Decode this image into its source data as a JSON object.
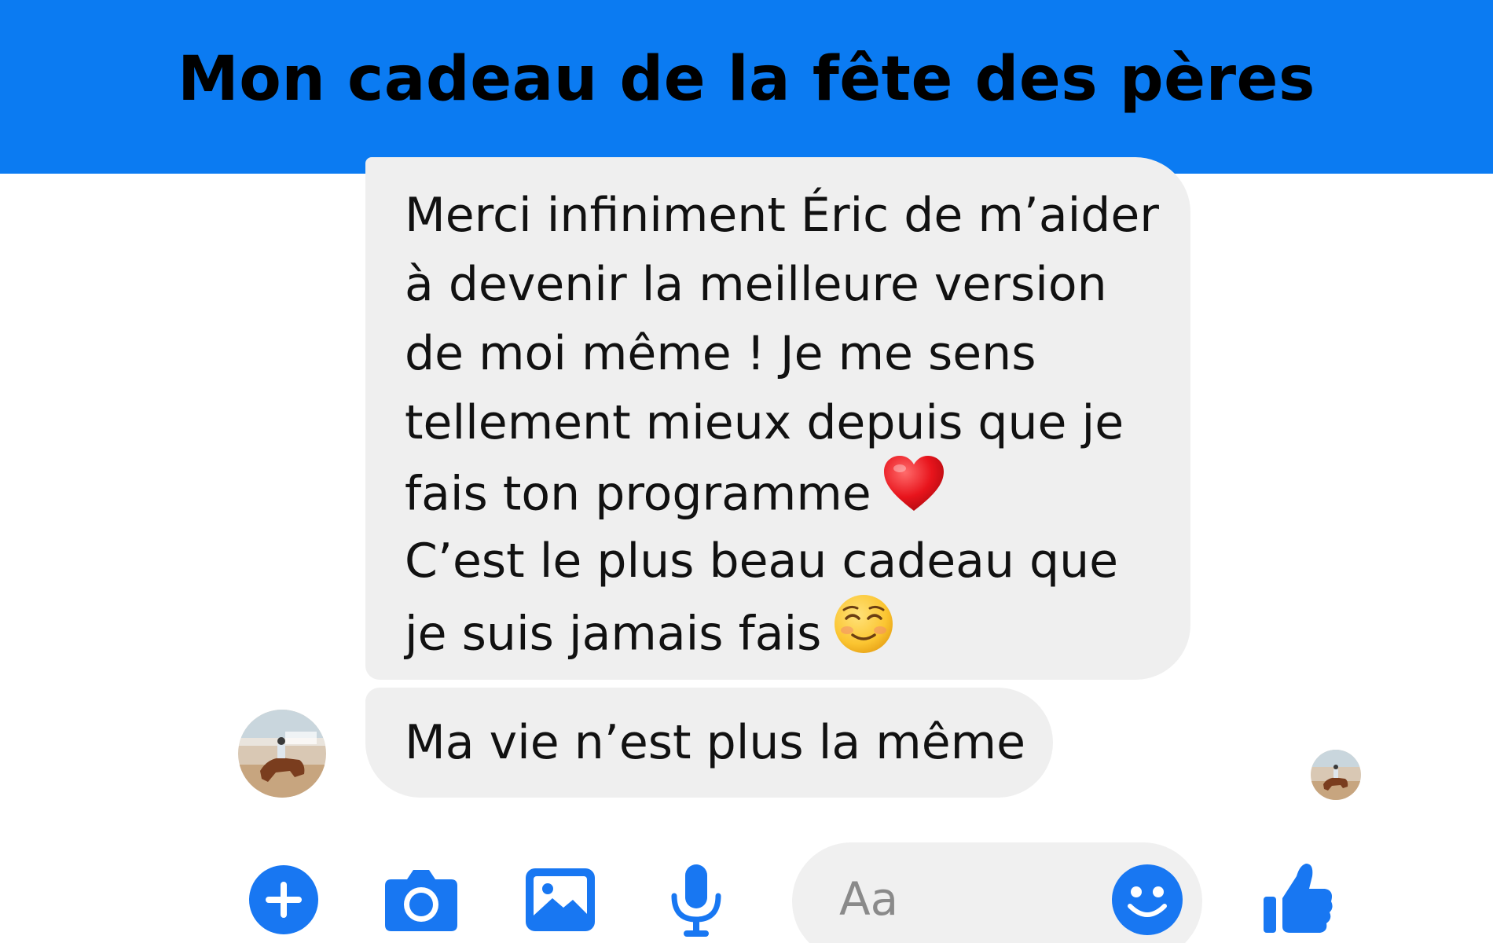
{
  "banner": {
    "title": "Mon cadeau de la fête des pères",
    "color": "#0b7bf2"
  },
  "conversation": {
    "messages": [
      {
        "lines": [
          "Merci infiniment Éric de m’aider",
          "à devenir la meilleure version",
          "de moi même ! Je me sens",
          "tellement mieux depuis que je",
          "fais ton programme",
          "C’est le plus beau cadeau que",
          "je suis jamais fais"
        ],
        "emojis": [
          "red-heart",
          "smiling-face"
        ]
      },
      {
        "text": "Ma vie n’est plus la même"
      }
    ],
    "sender_avatar": "horse-rider-photo",
    "read_receipt_avatar": "horse-rider-photo"
  },
  "composer": {
    "placeholder": "Aa",
    "icons": [
      "plus-icon",
      "camera-icon",
      "image-icon",
      "microphone-icon",
      "emoji-icon",
      "thumbs-up-icon"
    ],
    "icon_color": "#1877f2"
  }
}
